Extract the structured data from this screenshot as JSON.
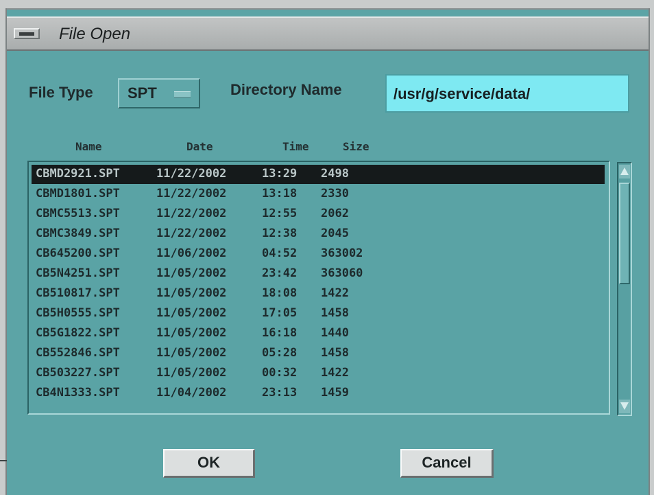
{
  "window": {
    "title": "File Open"
  },
  "file_type": {
    "label": "File Type",
    "value": "SPT"
  },
  "directory": {
    "label": "Directory Name",
    "value": "/usr/g/service/data/"
  },
  "columns": {
    "name": "Name",
    "date": "Date",
    "time": "Time",
    "size": "Size"
  },
  "files": [
    {
      "name": "CBMD2921.SPT",
      "date": "11/22/2002",
      "time": "13:29",
      "size": "2498",
      "selected": true
    },
    {
      "name": "CBMD1801.SPT",
      "date": "11/22/2002",
      "time": "13:18",
      "size": "2330"
    },
    {
      "name": "CBMC5513.SPT",
      "date": "11/22/2002",
      "time": "12:55",
      "size": "2062"
    },
    {
      "name": "CBMC3849.SPT",
      "date": "11/22/2002",
      "time": "12:38",
      "size": "2045"
    },
    {
      "name": "CB645200.SPT",
      "date": "11/06/2002",
      "time": "04:52",
      "size": "363002"
    },
    {
      "name": "CB5N4251.SPT",
      "date": "11/05/2002",
      "time": "23:42",
      "size": "363060"
    },
    {
      "name": "CB510817.SPT",
      "date": "11/05/2002",
      "time": "18:08",
      "size": "1422"
    },
    {
      "name": "CB5H0555.SPT",
      "date": "11/05/2002",
      "time": "17:05",
      "size": "1458"
    },
    {
      "name": "CB5G1822.SPT",
      "date": "11/05/2002",
      "time": "16:18",
      "size": "1440"
    },
    {
      "name": "CB552846.SPT",
      "date": "11/05/2002",
      "time": "05:28",
      "size": "1458"
    },
    {
      "name": "CB503227.SPT",
      "date": "11/05/2002",
      "time": "00:32",
      "size": "1422"
    },
    {
      "name": "CB4N1333.SPT",
      "date": "11/04/2002",
      "time": "23:13",
      "size": "1459"
    }
  ],
  "buttons": {
    "ok": "OK",
    "cancel": "Cancel"
  },
  "icons": {
    "window_menu": "window-menu-icon",
    "scroll_up": "arrow-up-icon",
    "scroll_down": "arrow-down-icon",
    "option_menu": "option-menu-indicator-icon"
  },
  "colors": {
    "background": "#5ca4a6",
    "input_field": "#7ee9f2",
    "selection": "#151a1b"
  }
}
